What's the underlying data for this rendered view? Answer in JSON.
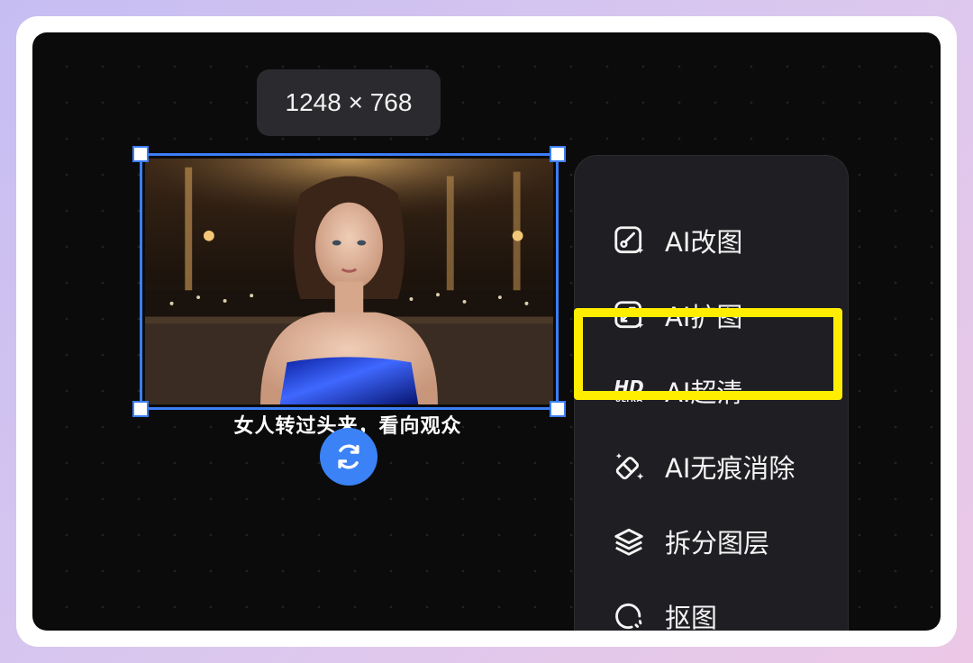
{
  "canvas": {
    "dimension_badge": "1248 × 768",
    "image_caption": "女人转过头来，看向观众"
  },
  "menu": {
    "items": [
      {
        "label": "AI改图",
        "icon": "ai-edit-icon"
      },
      {
        "label": "AI扩图",
        "icon": "ai-expand-icon"
      },
      {
        "label": "AI超清",
        "icon": "hd-ultra-icon",
        "icon_text_top": "HD",
        "icon_text_bottom": "ULTRA",
        "highlighted": true
      },
      {
        "label": "AI无痕消除",
        "icon": "eraser-icon"
      },
      {
        "label": "拆分图层",
        "icon": "layers-icon"
      },
      {
        "label": "抠图",
        "icon": "cutout-icon"
      }
    ]
  },
  "colors": {
    "selection": "#3b7ef5",
    "highlight": "#ffee00",
    "menu_bg": "#1f1f23",
    "canvas_bg": "#0b0b0c"
  }
}
